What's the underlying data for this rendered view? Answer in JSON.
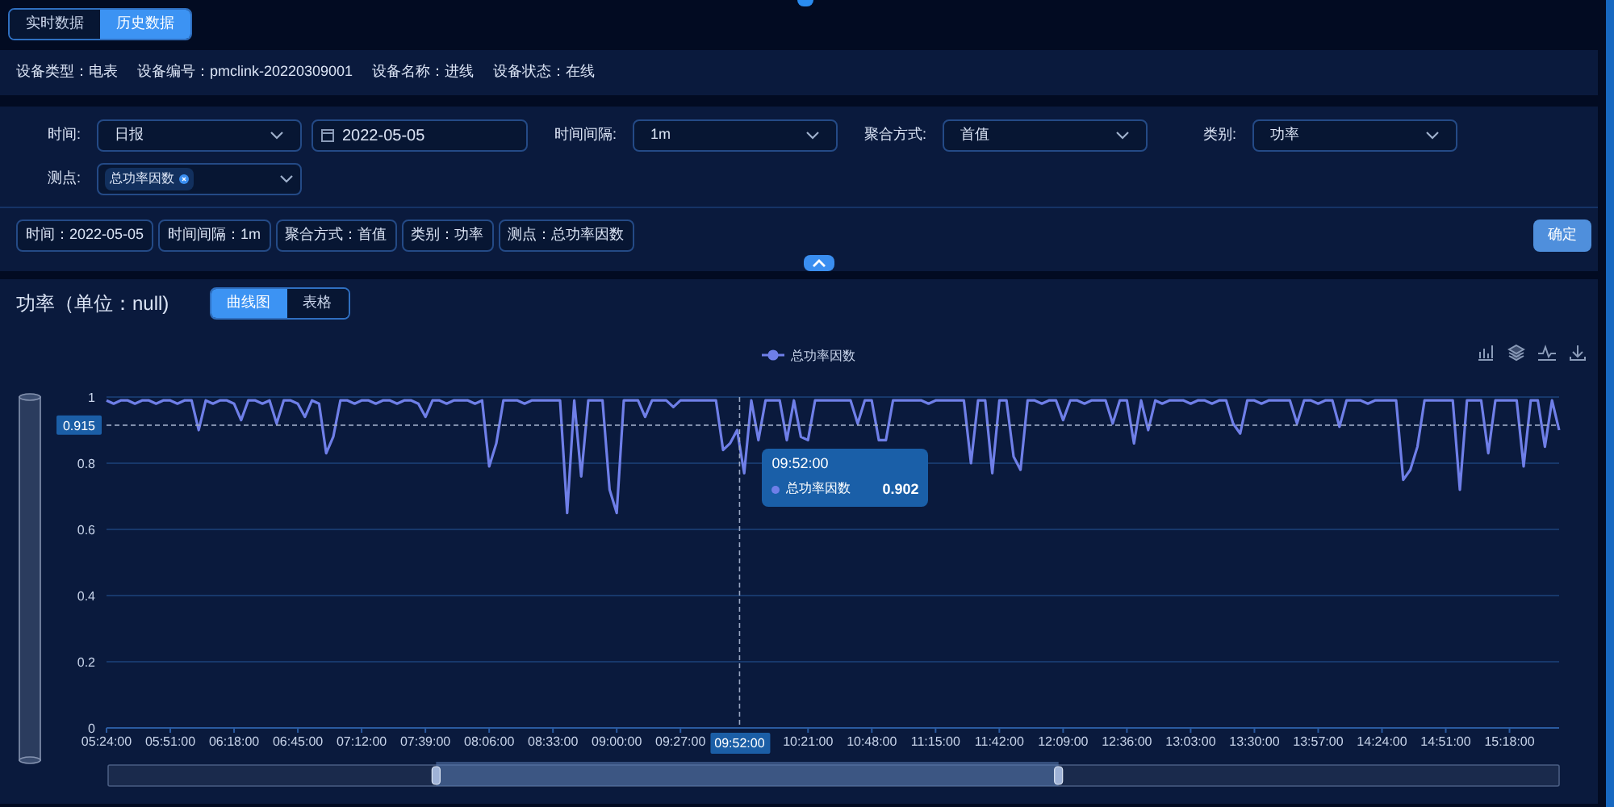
{
  "tabs": [
    {
      "label": "实时数据",
      "selected": false
    },
    {
      "label": "历史数据",
      "selected": true
    }
  ],
  "device_info": [
    "设备类型：电表",
    "设备编号：pmclink-20220309001",
    "设备名称：进线",
    "设备状态：在线"
  ],
  "filter_rows": [
    [
      {
        "kind": "select",
        "label": "时间:",
        "value": "日报"
      },
      {
        "kind": "date",
        "value": "2022-05-05"
      },
      {
        "kind": "select",
        "label": "时间间隔:",
        "value": "1m"
      },
      {
        "kind": "select",
        "label": "聚合方式:",
        "value": "首值"
      },
      {
        "kind": "select",
        "label": "类别:",
        "value": "功率"
      }
    ],
    [
      {
        "kind": "multiselect",
        "label": "测点:",
        "tags": [
          "总功率因数"
        ]
      }
    ]
  ],
  "summary_tags": [
    "时间：2022-05-05",
    "时间间隔：1m",
    "聚合方式：首值",
    "类别：功率",
    "测点：总功率因数"
  ],
  "confirm_button": "确定",
  "chart_panel": {
    "title": "功率（单位：null)",
    "view_tabs": [
      {
        "label": "曲线图",
        "selected": true
      },
      {
        "label": "表格",
        "selected": false
      }
    ],
    "tooltip": {
      "time": "09:52:00",
      "series": "总功率因数",
      "value": "0.902"
    },
    "zoom_slider": {
      "handles": [
        {
          "level": 0.226
        },
        {
          "level": 0.655
        }
      ]
    },
    "axis_pointer": {
      "label": "09:52:00",
      "level": 0.4358
    },
    "chart_data": {
      "type": "line",
      "grid": true,
      "ylim": [
        0,
        1
      ],
      "yticks": [
        0,
        0.2,
        0.4,
        0.6,
        0.8,
        1
      ],
      "ref_lines": [
        {
          "axis": "y",
          "value": 0.915,
          "label": "0.915"
        }
      ],
      "categories": [
        "05:24:00",
        null,
        null,
        null,
        null,
        null,
        null,
        null,
        null,
        "05:51:00",
        null,
        null,
        null,
        null,
        null,
        null,
        null,
        null,
        "06:18:00",
        null,
        null,
        null,
        null,
        null,
        null,
        null,
        null,
        "06:45:00",
        null,
        null,
        null,
        null,
        null,
        null,
        null,
        null,
        "07:12:00",
        null,
        null,
        null,
        null,
        null,
        null,
        null,
        null,
        "07:39:00",
        null,
        null,
        null,
        null,
        null,
        null,
        null,
        null,
        "08:06:00",
        null,
        null,
        null,
        null,
        null,
        null,
        null,
        null,
        "08:33:00",
        null,
        null,
        null,
        null,
        null,
        null,
        null,
        null,
        "09:00:00",
        null,
        null,
        null,
        null,
        null,
        null,
        null,
        null,
        "09:27:00",
        null,
        null,
        null,
        null,
        null,
        null,
        null,
        null,
        null,
        null,
        null,
        null,
        null,
        null,
        null,
        null,
        null,
        "10:21:00",
        null,
        null,
        null,
        null,
        null,
        null,
        null,
        null,
        "10:48:00",
        null,
        null,
        null,
        null,
        null,
        null,
        null,
        null,
        "11:15:00",
        null,
        null,
        null,
        null,
        null,
        null,
        null,
        null,
        "11:42:00",
        null,
        null,
        null,
        null,
        null,
        null,
        null,
        null,
        "12:09:00",
        null,
        null,
        null,
        null,
        null,
        null,
        null,
        null,
        "12:36:00",
        null,
        null,
        null,
        null,
        null,
        null,
        null,
        null,
        "13:03:00",
        null,
        null,
        null,
        null,
        null,
        null,
        null,
        null,
        "13:30:00",
        null,
        null,
        null,
        null,
        null,
        null,
        null,
        null,
        "13:57:00",
        null,
        null,
        null,
        null,
        null,
        null,
        null,
        null,
        "14:24:00",
        null,
        null,
        null,
        null,
        null,
        null,
        null,
        null,
        "14:51:00",
        null,
        null,
        null,
        null,
        null,
        null,
        null,
        null,
        "15:18:00",
        null,
        null,
        null,
        null,
        null,
        null,
        null
      ],
      "series": [
        {
          "name": "总功率因数",
          "color": "#6f7fe8",
          "values": [
            0.99,
            0.98,
            0.99,
            0.99,
            0.98,
            0.99,
            0.99,
            0.98,
            0.99,
            0.99,
            0.98,
            0.99,
            0.99,
            0.9,
            0.99,
            0.98,
            0.99,
            0.99,
            0.98,
            0.93,
            0.99,
            0.99,
            0.98,
            0.99,
            0.92,
            0.99,
            0.99,
            0.98,
            0.94,
            0.99,
            0.98,
            0.83,
            0.88,
            0.99,
            0.99,
            0.98,
            0.99,
            0.99,
            0.98,
            0.99,
            0.99,
            0.98,
            0.99,
            0.99,
            0.98,
            0.94,
            0.99,
            0.99,
            0.98,
            0.99,
            0.99,
            0.99,
            0.98,
            0.99,
            0.79,
            0.86,
            0.99,
            0.99,
            0.99,
            0.98,
            0.99,
            0.99,
            0.99,
            0.99,
            0.99,
            0.65,
            0.99,
            0.76,
            0.99,
            0.99,
            0.99,
            0.72,
            0.65,
            0.99,
            0.99,
            0.99,
            0.94,
            0.99,
            0.99,
            0.99,
            0.97,
            0.99,
            0.99,
            0.99,
            0.99,
            0.99,
            0.99,
            0.84,
            0.86,
            0.9,
            0.77,
            0.99,
            0.87,
            0.99,
            0.99,
            0.99,
            0.87,
            0.99,
            0.88,
            0.87,
            0.99,
            0.99,
            0.99,
            0.99,
            0.99,
            0.99,
            0.92,
            0.99,
            0.99,
            0.87,
            0.87,
            0.99,
            0.99,
            0.99,
            0.99,
            0.99,
            0.98,
            0.99,
            0.99,
            0.99,
            0.99,
            0.99,
            0.8,
            0.99,
            0.99,
            0.77,
            0.99,
            0.99,
            0.82,
            0.78,
            0.99,
            0.99,
            0.98,
            0.99,
            0.99,
            0.93,
            0.99,
            0.99,
            0.98,
            0.99,
            0.99,
            0.99,
            0.92,
            0.99,
            0.99,
            0.86,
            0.99,
            0.9,
            0.99,
            0.98,
            0.99,
            0.99,
            0.99,
            0.98,
            0.99,
            0.99,
            0.98,
            0.99,
            0.99,
            0.92,
            0.89,
            0.99,
            0.99,
            0.98,
            0.99,
            0.99,
            0.99,
            0.99,
            0.92,
            0.99,
            0.99,
            0.98,
            0.99,
            0.99,
            0.91,
            0.99,
            0.99,
            0.99,
            0.98,
            0.99,
            0.99,
            0.99,
            0.99,
            0.75,
            0.78,
            0.85,
            0.99,
            0.99,
            0.99,
            0.99,
            0.99,
            0.72,
            0.99,
            0.99,
            0.99,
            0.83,
            0.99,
            0.99,
            0.99,
            0.99,
            0.79,
            0.99,
            0.99,
            0.85,
            0.99,
            0.9
          ]
        }
      ]
    }
  }
}
